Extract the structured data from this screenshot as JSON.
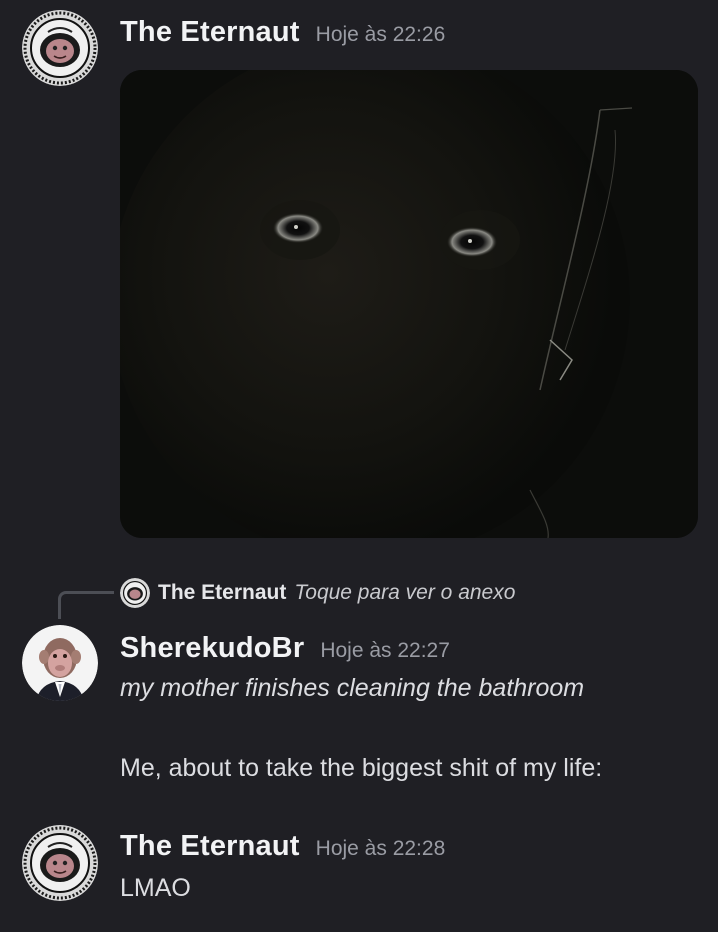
{
  "messages": [
    {
      "username": "The Eternaut",
      "timestamp": "Hoje às 22:26",
      "avatar_icon": "astronaut-avatar-icon",
      "attachment": "dark-face-image"
    },
    {
      "reply": {
        "username": "The Eternaut",
        "text": "Toque para ver o anexo",
        "avatar_icon": "astronaut-avatar-icon"
      },
      "username": "SherekudoBr",
      "timestamp": "Hoje às 22:27",
      "avatar_icon": "monkey-in-suit-avatar-icon",
      "line1": "my mother finishes cleaning the bathroom",
      "line2": "Me, about to take the biggest shit of my life:"
    },
    {
      "username": "The Eternaut",
      "timestamp": "Hoje às 22:28",
      "avatar_icon": "astronaut-avatar-icon",
      "text": "LMAO"
    }
  ],
  "colors": {
    "background": "#1f1f24",
    "timestamp": "#9a9ca4",
    "reply_spine": "#4c4e55"
  }
}
